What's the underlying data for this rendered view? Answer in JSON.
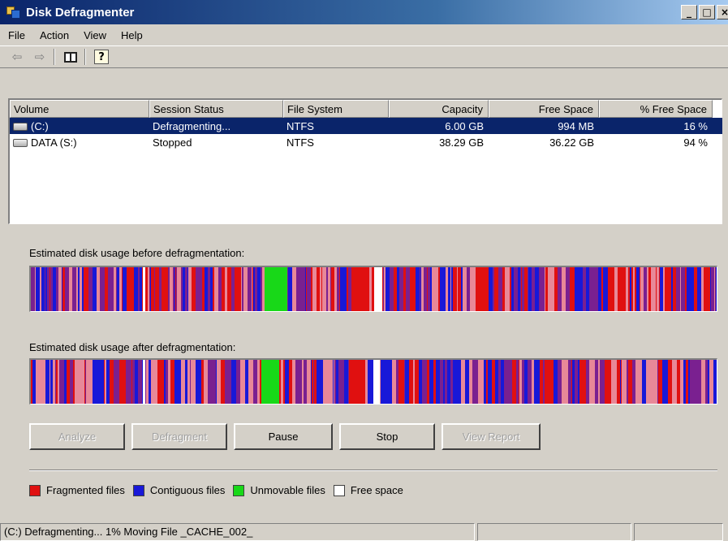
{
  "window": {
    "title": "Disk Defragmenter"
  },
  "menu": {
    "items": [
      "File",
      "Action",
      "View",
      "Help"
    ]
  },
  "toolbar": {
    "icons": [
      "back-arrow-icon",
      "forward-arrow-icon",
      "show-hide-console-tree-icon",
      "help-icon"
    ]
  },
  "volumes": {
    "columns": [
      "Volume",
      "Session Status",
      "File System",
      "Capacity",
      "Free Space",
      "% Free Space"
    ],
    "rows": [
      {
        "volume": "(C:)",
        "status": "Defragmenting...",
        "fs": "NTFS",
        "capacity": "6.00 GB",
        "free": "994 MB",
        "pct": "16 %",
        "selected": true
      },
      {
        "volume": "DATA (S:)",
        "status": "Stopped",
        "fs": "NTFS",
        "capacity": "38.29 GB",
        "free": "36.22 GB",
        "pct": "94 %",
        "selected": false
      }
    ]
  },
  "analysis": {
    "before_label": "Estimated disk usage before defragmentation:",
    "after_label": "Estimated disk usage after defragmentation:",
    "colors": {
      "fragmented": "#e01010",
      "contiguous": "#1818d8",
      "unmovable": "#18d818",
      "free": "#ffffff",
      "system": "#7a2090",
      "pink": "#e88898"
    }
  },
  "buttons": {
    "analyze": "Analyze",
    "defragment": "Defragment",
    "pause": "Pause",
    "stop": "Stop",
    "view_report": "View Report"
  },
  "legend": [
    {
      "label": "Fragmented files",
      "color": "#e01010"
    },
    {
      "label": "Contiguous files",
      "color": "#1818d8"
    },
    {
      "label": "Unmovable files",
      "color": "#18d818"
    },
    {
      "label": "Free space",
      "color": "#ffffff"
    }
  ],
  "status": {
    "text": "(C:) Defragmenting... 1%  Moving File _CACHE_002_"
  }
}
